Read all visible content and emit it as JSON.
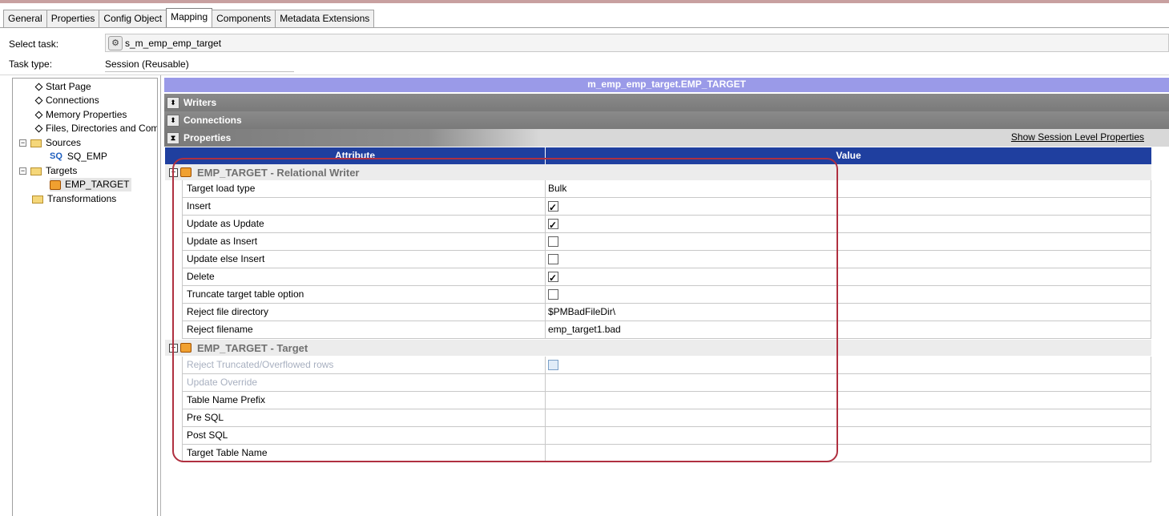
{
  "tabs": [
    {
      "label": "General",
      "active": false
    },
    {
      "label": "Properties",
      "active": false
    },
    {
      "label": "Config Object",
      "active": false
    },
    {
      "label": "Mapping",
      "active": true
    },
    {
      "label": "Components",
      "active": false
    },
    {
      "label": "Metadata Extensions",
      "active": false
    }
  ],
  "task": {
    "select_label": "Select task:",
    "select_value": "s_m_emp_emp_target",
    "type_label": "Task type:",
    "type_value": "Session (Reusable)"
  },
  "tree": {
    "items": [
      {
        "label": "Start Page"
      },
      {
        "label": "Connections"
      },
      {
        "label": "Memory Properties"
      },
      {
        "label": "Files, Directories and Com"
      },
      {
        "label": "Sources"
      },
      {
        "label": "SQ_EMP",
        "icon_text": "SQ"
      },
      {
        "label": "Targets"
      },
      {
        "label": "EMP_TARGET"
      },
      {
        "label": "Transformations"
      }
    ]
  },
  "main": {
    "header": "m_emp_emp_target.EMP_TARGET",
    "writers_label": "Writers",
    "connections_label": "Connections",
    "properties_label": "Properties",
    "show_session_link": "Show Session Level Properties",
    "col_attribute": "Attribute",
    "col_value": "Value"
  },
  "sections": [
    {
      "title": "EMP_TARGET - Relational Writer",
      "rows": [
        {
          "attr": "Target load type",
          "value": "Bulk"
        },
        {
          "attr": "Insert",
          "checked": true
        },
        {
          "attr": "Update as Update",
          "checked": true
        },
        {
          "attr": "Update as Insert",
          "checked": false
        },
        {
          "attr": "Update else Insert",
          "checked": false
        },
        {
          "attr": "Delete",
          "checked": true
        },
        {
          "attr": "Truncate target table option",
          "checked": false
        },
        {
          "attr": "Reject file directory",
          "value": "$PMBadFileDir\\"
        },
        {
          "attr": "Reject filename",
          "value": "emp_target1.bad"
        }
      ]
    },
    {
      "title": "EMP_TARGET - Target",
      "rows": [
        {
          "attr": "Reject Truncated/Overflowed rows",
          "checked": false,
          "disabled": true
        },
        {
          "attr": "Update Override",
          "value": "",
          "disabled": true
        },
        {
          "attr": "Table Name Prefix",
          "value": ""
        },
        {
          "attr": "Pre SQL",
          "value": ""
        },
        {
          "attr": "Post SQL",
          "value": ""
        },
        {
          "attr": "Target Table Name",
          "value": ""
        }
      ]
    }
  ],
  "colors": {
    "header_bar": "#9a9ae8",
    "column_header": "#1f3f9f",
    "highlight_outline": "#b03040"
  }
}
